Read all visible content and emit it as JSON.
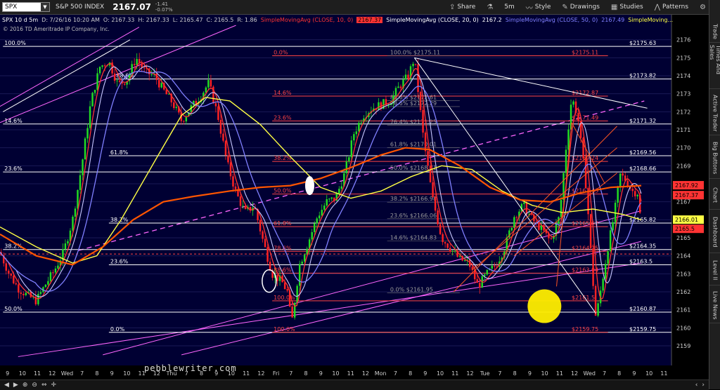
{
  "toolbar": {
    "symbol": "SPX",
    "index_name": "S&P 500 INDEX",
    "price": "2167.07",
    "change": "-1.41",
    "change_pct": "-0.07%",
    "share_label": "Share",
    "timeframe_label": "5m",
    "style_label": "Style",
    "drawings_label": "Drawings",
    "studies_label": "Studies",
    "patterns_label": "Patterns"
  },
  "infobar": {
    "title": "SPX 10 d 5m",
    "date": "D: 7/26/16 10:20 AM",
    "open": "O: 2167.33",
    "high": "H: 2167.33",
    "low": "L: 2165.47",
    "close": "C: 2165.5",
    "range": "R: 1.86",
    "sma10": "SimpleMovingAvg (CLOSE, 10, 0)",
    "sma10_val": "2167.37",
    "sma20": "SimpleMovingAvg (CLOSE, 20, 0)",
    "sma20_val": "2167.2",
    "sma50": "SimpleMovingAvg (CLOSE, 50, 0)",
    "sma50_val": "2167.49",
    "sma_more": "SimpleMoving..."
  },
  "copyright": "© 2016 TD Ameritrade IP Company, Inc.",
  "watermark": "pebblewriter.com",
  "sidebar": [
    "Trade",
    "Times And Sales",
    "Active Trader",
    "Big Buttons",
    "Chart",
    "Dashboard",
    "Level II",
    "Live News"
  ],
  "colors": {
    "background": "#000033",
    "sma10": "#ff3333",
    "sma20": "#c8c8ff",
    "sma50": "#8080ff",
    "sma100": "#ffff44",
    "sma200": "#ff5500",
    "fib_red": "#ff4444",
    "fib_white": "#ffffff",
    "channel_magenta": "#ff66ff",
    "highlight": "#ffee00"
  },
  "chart_data": {
    "type": "candlestick",
    "ylim": [
      2158.3,
      2177
    ],
    "y_ticks": [
      2159,
      2160,
      2161,
      2162,
      2163,
      2164,
      2165,
      2166,
      2167,
      2168,
      2169,
      2170,
      2171,
      2172,
      2173,
      2174,
      2175,
      2176
    ],
    "x_tick_labels": [
      "9",
      "10",
      "11",
      "12",
      "Wed",
      "7",
      "8",
      "9",
      "10",
      "11",
      "12",
      "Thu",
      "7",
      "8",
      "9",
      "10",
      "11",
      "12",
      "Fri",
      "7",
      "8",
      "9",
      "10",
      "11",
      "12",
      "Mon",
      "7",
      "8",
      "9",
      "10",
      "11",
      "12",
      "Tue",
      "7",
      "8",
      "9",
      "10",
      "11",
      "12",
      "Wed",
      "7",
      "8",
      "9",
      "10",
      "11"
    ],
    "price_path": [
      [
        0,
        2164.2
      ],
      [
        0.15,
        2163.0
      ],
      [
        0.3,
        2162.2
      ],
      [
        0.45,
        2161.8
      ],
      [
        0.6,
        2161.5
      ],
      [
        0.75,
        2162.4
      ],
      [
        0.9,
        2163.2
      ],
      [
        1.05,
        2164.2
      ],
      [
        1.2,
        2166.0
      ],
      [
        1.35,
        2169.0
      ],
      [
        1.5,
        2172.5
      ],
      [
        1.65,
        2174.5
      ],
      [
        1.8,
        2174.8
      ],
      [
        1.95,
        2173.5
      ],
      [
        2.1,
        2173.8
      ],
      [
        2.25,
        2175.0
      ],
      [
        2.4,
        2174.2
      ],
      [
        2.55,
        2174.0
      ],
      [
        2.7,
        2173.2
      ],
      [
        2.85,
        2172.5
      ],
      [
        3.0,
        2171.5
      ],
      [
        3.15,
        2172.2
      ],
      [
        3.3,
        2172.8
      ],
      [
        3.45,
        2173.6
      ],
      [
        3.6,
        2171.8
      ],
      [
        3.75,
        2169.2
      ],
      [
        3.9,
        2167.5
      ],
      [
        4.05,
        2166.4
      ],
      [
        4.2,
        2166.8
      ],
      [
        4.35,
        2164.8
      ],
      [
        4.5,
        2163.0
      ],
      [
        4.65,
        2162.6
      ],
      [
        4.75,
        2162.0
      ],
      [
        4.82,
        2160.2
      ],
      [
        4.95,
        2163.5
      ],
      [
        5.1,
        2164.8
      ],
      [
        5.25,
        2166.2
      ],
      [
        5.4,
        2167.0
      ],
      [
        5.55,
        2167.2
      ],
      [
        5.7,
        2168.6
      ],
      [
        5.85,
        2170.8
      ],
      [
        6.0,
        2171.8
      ],
      [
        6.15,
        2172.2
      ],
      [
        6.3,
        2172.4
      ],
      [
        6.45,
        2172.6
      ],
      [
        6.6,
        2173.4
      ],
      [
        6.75,
        2174.0
      ],
      [
        6.85,
        2175.0
      ],
      [
        7.0,
        2170.5
      ],
      [
        7.15,
        2167.2
      ],
      [
        7.3,
        2165.0
      ],
      [
        7.45,
        2164.4
      ],
      [
        7.6,
        2163.8
      ],
      [
        7.75,
        2163.6
      ],
      [
        7.9,
        2162.3
      ],
      [
        8.05,
        2163.0
      ],
      [
        8.2,
        2163.5
      ],
      [
        8.35,
        2164.5
      ],
      [
        8.5,
        2166.2
      ],
      [
        8.65,
        2166.8
      ],
      [
        8.8,
        2166.0
      ],
      [
        8.95,
        2165.5
      ],
      [
        9.1,
        2164.8
      ],
      [
        9.25,
        2166.2
      ],
      [
        9.35,
        2169.8
      ],
      [
        9.45,
        2172.8
      ],
      [
        9.55,
        2171.8
      ],
      [
        9.7,
        2167.5
      ],
      [
        9.78,
        2163.5
      ],
      [
        9.85,
        2160.5
      ],
      [
        9.95,
        2162.5
      ],
      [
        10.05,
        2164.5
      ],
      [
        10.15,
        2166.2
      ],
      [
        10.25,
        2168.5
      ],
      [
        10.35,
        2168.2
      ],
      [
        10.45,
        2167.6
      ],
      [
        10.55,
        2167.5
      ],
      [
        10.6,
        2165.5
      ]
    ],
    "series": [
      {
        "name": "SimpleMovingAvg (CLOSE, 10, 0)",
        "values_ref": "sma10"
      },
      {
        "name": "SimpleMovingAvg (CLOSE, 20, 0)",
        "values_ref": "sma20"
      },
      {
        "name": "SimpleMovingAvg (CLOSE, 50, 0)",
        "values_ref": "sma50"
      }
    ],
    "moving_averages": {
      "sma100": [
        [
          0,
          2165.6
        ],
        [
          0.6,
          2164.5
        ],
        [
          1.2,
          2163.6
        ],
        [
          1.6,
          2164.0
        ],
        [
          2.0,
          2166.0
        ],
        [
          2.6,
          2169.5
        ],
        [
          3.0,
          2171.8
        ],
        [
          3.4,
          2172.8
        ],
        [
          3.8,
          2172.6
        ],
        [
          4.3,
          2171.3
        ],
        [
          4.8,
          2169.5
        ],
        [
          5.3,
          2167.8
        ],
        [
          5.8,
          2167.2
        ],
        [
          6.3,
          2167.6
        ],
        [
          6.8,
          2168.4
        ],
        [
          7.3,
          2169.0
        ],
        [
          7.8,
          2168.8
        ],
        [
          8.3,
          2167.6
        ],
        [
          8.8,
          2166.8
        ],
        [
          9.3,
          2166.4
        ],
        [
          9.8,
          2166.6
        ],
        [
          10.3,
          2166.3
        ],
        [
          10.6,
          2166.0
        ]
      ],
      "sma200": [
        [
          0,
          2165.2
        ],
        [
          0.6,
          2164.0
        ],
        [
          1.2,
          2163.5
        ],
        [
          1.7,
          2164.5
        ],
        [
          2.2,
          2166.0
        ],
        [
          2.7,
          2167.0
        ],
        [
          3.2,
          2167.3
        ],
        [
          3.8,
          2167.6
        ],
        [
          4.3,
          2167.8
        ],
        [
          4.8,
          2167.9
        ],
        [
          5.3,
          2168.3
        ],
        [
          5.8,
          2168.9
        ],
        [
          6.3,
          2169.6
        ],
        [
          6.7,
          2170.0
        ],
        [
          7.1,
          2169.9
        ],
        [
          7.6,
          2169.0
        ],
        [
          8.1,
          2167.8
        ],
        [
          8.6,
          2167.1
        ],
        [
          9.1,
          2167.0
        ],
        [
          9.6,
          2167.5
        ],
        [
          10.1,
          2167.8
        ],
        [
          10.6,
          2167.9
        ]
      ]
    },
    "fib_white": [
      {
        "label": "100.0%",
        "price": 2175.63,
        "val": "$2175.63"
      },
      {
        "label": "88.6%",
        "price": 2173.82,
        "val": "$2173.82"
      },
      {
        "label": "14.6%",
        "price": 2171.32,
        "val": "$2171.32"
      },
      {
        "label": "61.8%",
        "price": 2169.56,
        "val": "$2169.56"
      },
      {
        "label": "23.6%",
        "price": 2168.66,
        "val": "$2168.66"
      },
      {
        "label": "38.2%",
        "price": 2165.82,
        "val": "$2165.82"
      },
      {
        "label": "38.2%",
        "price": 2164.35,
        "val": "$2164.35"
      },
      {
        "label": "23.6%",
        "price": 2163.5,
        "val": "$2163.5"
      },
      {
        "label": "50.0%",
        "price": 2160.87,
        "val": "$2160.87"
      },
      {
        "label": "0.0%",
        "price": 2159.75,
        "val": "$2159.75"
      }
    ],
    "fib_red": [
      {
        "label": "0.0%",
        "price": 2175.11,
        "val": "$2175.11"
      },
      {
        "label": "14.6%",
        "price": 2172.87,
        "val": "$2172.87"
      },
      {
        "label": "23.6%",
        "price": 2171.49,
        "val": "$2171.49"
      },
      {
        "label": "38.2%",
        "price": 2169.24,
        "val": "$2169.24"
      },
      {
        "label": "50.0%",
        "price": 2167.43,
        "val": "$2167.43"
      },
      {
        "label": "61.8%",
        "price": 2165.62,
        "val": "$2165.62"
      },
      {
        "label": "78.6%",
        "price": 2164.25,
        "val": "$2164.25"
      },
      {
        "label": "88.6%",
        "price": 2163.04,
        "val": "$2163.04"
      },
      {
        "label": "100.0%",
        "price": 2161.5,
        "val": "$2161.5"
      },
      {
        "label": "100.0%",
        "price": 2159.75,
        "val": "$2159.75"
      }
    ],
    "fib_inner": [
      {
        "label": "100.0%",
        "price": 2175.11,
        "val": "$2175.11"
      },
      {
        "label": "88.6%",
        "price": 2172.61,
        "val": "$2172.61"
      },
      {
        "label": "78.6%",
        "price": 2172.29,
        "val": "$2172.29"
      },
      {
        "label": "76.4%",
        "price": 2171.25,
        "val": "$2171.25"
      },
      {
        "label": "61.8%",
        "price": 2170.01,
        "val": "$2170.01"
      },
      {
        "label": "50.0%",
        "price": 2168.71,
        "val": "$2168.71"
      },
      {
        "label": "38.2%",
        "price": 2166.98,
        "val": "$2166.98"
      },
      {
        "label": "23.6%",
        "price": 2166.06,
        "val": "$2166.06"
      },
      {
        "label": "14.6%",
        "price": 2164.83,
        "val": "$2164.83"
      },
      {
        "label": "0.0%",
        "price": 2161.95,
        "val": "$2161.95"
      }
    ],
    "axis_labels": [
      {
        "price": 2167.92,
        "text": "2167.92",
        "color": "#ff3333"
      },
      {
        "price": 2167.37,
        "text": "2167.37",
        "color": "#ff3333"
      },
      {
        "price": 2166.01,
        "text": "2166.01",
        "color": "#ffff44"
      },
      {
        "price": 2165.5,
        "text": "2165.5",
        "color": "#ff3333"
      }
    ]
  }
}
